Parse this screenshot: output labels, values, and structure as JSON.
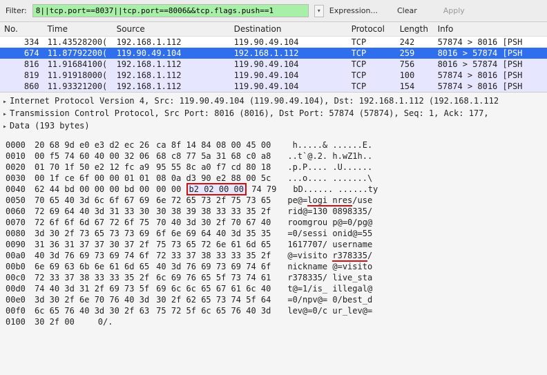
{
  "filter": {
    "label": "Filter:",
    "value": "8||tcp.port==8037||tcp.port==8006&&tcp.flags.push==1",
    "expression": "Expression...",
    "clear": "Clear",
    "apply": "Apply"
  },
  "packets": {
    "headers": {
      "no": "No.",
      "time": "Time",
      "src": "Source",
      "dst": "Destination",
      "proto": "Protocol",
      "len": "Length",
      "info": "Info"
    },
    "rows": [
      {
        "no": "334",
        "time": "11.43528200(",
        "src": "192.168.1.112",
        "dst": "119.90.49.104",
        "proto": "TCP",
        "len": "242",
        "info": "57874 > 8016 [PSH",
        "cls": ""
      },
      {
        "no": "674",
        "time": "11.87792200(",
        "src": "119.90.49.104",
        "dst": "192.168.1.112",
        "proto": "TCP",
        "len": "259",
        "info": "8016 > 57874 [PSH",
        "cls": "sel"
      },
      {
        "no": "816",
        "time": "11.91684100(",
        "src": "192.168.1.112",
        "dst": "119.90.49.104",
        "proto": "TCP",
        "len": "756",
        "info": "8016 > 57874 [PSH",
        "cls": "alt"
      },
      {
        "no": "819",
        "time": "11.91918000(",
        "src": "192.168.1.112",
        "dst": "119.90.49.104",
        "proto": "TCP",
        "len": "100",
        "info": "57874 > 8016 [PSH",
        "cls": "alt"
      },
      {
        "no": "860",
        "time": "11.93321200(",
        "src": "192.168.1.112",
        "dst": "119.90.49.104",
        "proto": "TCP",
        "len": "154",
        "info": "57874 > 8016 [PSH",
        "cls": "alt"
      }
    ]
  },
  "tree": {
    "ip": "Internet Protocol Version 4, Src: 119.90.49.104 (119.90.49.104), Dst: 192.168.1.112 (192.168.1.112",
    "tcp": "Transmission Control Protocol, Src Port: 8016 (8016), Dst Port: 57874 (57874), Seq: 1, Ack: 177, ",
    "data": "Data (193 bytes)"
  },
  "hex": {
    "lines": [
      {
        "ofs": "0000",
        "b1": "20 68 9d e0 e3 d2 ec 26",
        "b2": "ca 8f 14 84 08 00 45 00",
        "ascii": " h.....& ......E."
      },
      {
        "ofs": "0010",
        "b1": "00 f5 74 60 40 00 32 06",
        "b2": "68 c8 77 5a 31 68 c0 a8",
        "ascii": "..t`@.2. h.wZ1h.."
      },
      {
        "ofs": "0020",
        "b1": "01 70 1f 50 e2 12 fc a9",
        "b2": "95 55 8c a0 f7 cd 80 18",
        "ascii": ".p.P.... .U......"
      },
      {
        "ofs": "0030",
        "b1": "00 1f ce 6f 00 00 01 01",
        "b2": "08 0a d3 90 e2 88 00 5c",
        "ascii": "...o.... .......\\"
      },
      {
        "ofs": "0040",
        "b1": "62 44 bd 00 00 00 bd 00",
        "b2p": "00 00 ",
        "box": "b2 02 00 00",
        "b2s": " 74 79",
        "ascii": "bD...... ......ty"
      },
      {
        "ofs": "0050",
        "b1": "70 65 40 3d 6c 6f 67 69",
        "b2": "6e 72 65 73 2f 75 73 65",
        "apre": "pe@=",
        "aul": "logi nres",
        "apost": "/use"
      },
      {
        "ofs": "0060",
        "b1": "72 69 64 40 3d 31 33 30",
        "b2": "30 38 39 38 33 33 35 2f",
        "ascii": "rid@=130 0898335/"
      },
      {
        "ofs": "0070",
        "b1": "72 6f 6f 6d 67 72 6f 75",
        "b2": "70 40 3d 30 2f 70 67 40",
        "ascii": "roomgrou p@=0/pg@"
      },
      {
        "ofs": "0080",
        "b1": "3d 30 2f 73 65 73 73 69",
        "b2": "6f 6e 69 64 40 3d 35 35",
        "ascii": "=0/sessi onid@=55"
      },
      {
        "ofs": "0090",
        "b1": "31 36 31 37 37 30 37 2f",
        "b2": "75 73 65 72 6e 61 6d 65",
        "ascii": "1617707/ username"
      },
      {
        "ofs": "00a0",
        "b1": "40 3d 76 69 73 69 74 6f",
        "b2": "72 33 37 38 33 33 35 2f",
        "apre": "@=visito ",
        "aul": "r378335",
        "apost": "/"
      },
      {
        "ofs": "00b0",
        "b1": "6e 69 63 6b 6e 61 6d 65",
        "b2": "40 3d 76 69 73 69 74 6f",
        "ascii": "nickname @=visito"
      },
      {
        "ofs": "00c0",
        "b1": "72 33 37 38 33 33 35 2f",
        "b2": "6c 69 76 65 5f 73 74 61",
        "ascii": "r378335/ live_sta"
      },
      {
        "ofs": "00d0",
        "b1": "74 40 3d 31 2f 69 73 5f",
        "b2": "69 6c 6c 65 67 61 6c 40",
        "ascii": "t@=1/is_ illegal@"
      },
      {
        "ofs": "00e0",
        "b1": "3d 30 2f 6e 70 76 40 3d",
        "b2": "30 2f 62 65 73 74 5f 64",
        "ascii": "=0/npv@= 0/best_d"
      },
      {
        "ofs": "00f0",
        "b1": "6c 65 76 40 3d 30 2f 63",
        "b2": "75 72 5f 6c 65 76 40 3d",
        "ascii": "lev@=0/c ur_lev@="
      },
      {
        "ofs": "0100",
        "b1": "30 2f 00",
        "b2": "",
        "ascii": "0/."
      }
    ]
  }
}
